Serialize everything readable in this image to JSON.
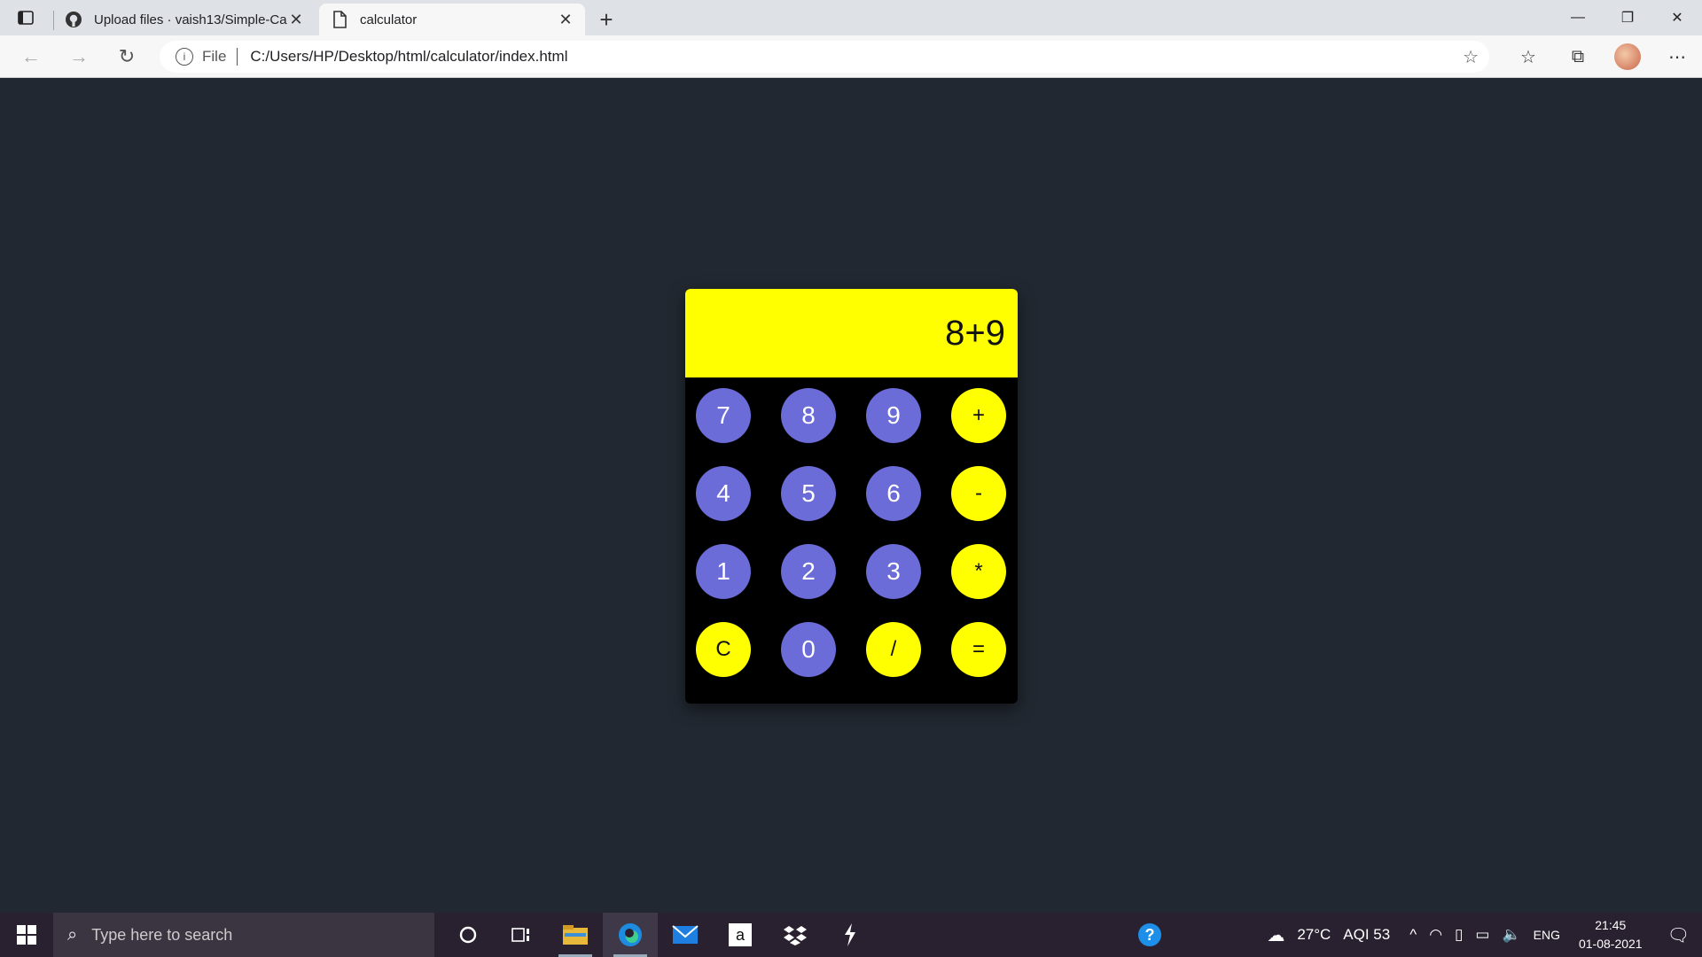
{
  "browser": {
    "tabs": [
      {
        "title": "Upload files · vaish13/Simple-Cal",
        "active": false,
        "favicon": "github-icon"
      },
      {
        "title": "calculator",
        "active": true,
        "favicon": "page-icon"
      }
    ],
    "address": {
      "scheme_label": "File",
      "url": "C:/Users/HP/Desktop/html/calculator/index.html"
    }
  },
  "calculator": {
    "display": "8+9",
    "keys": [
      {
        "label": "7",
        "type": "num"
      },
      {
        "label": "8",
        "type": "num"
      },
      {
        "label": "9",
        "type": "num"
      },
      {
        "label": "+",
        "type": "op"
      },
      {
        "label": "4",
        "type": "num"
      },
      {
        "label": "5",
        "type": "num"
      },
      {
        "label": "6",
        "type": "num"
      },
      {
        "label": "-",
        "type": "op"
      },
      {
        "label": "1",
        "type": "num"
      },
      {
        "label": "2",
        "type": "num"
      },
      {
        "label": "3",
        "type": "num"
      },
      {
        "label": "*",
        "type": "op"
      },
      {
        "label": "C",
        "type": "op"
      },
      {
        "label": "0",
        "type": "num"
      },
      {
        "label": "/",
        "type": "op"
      },
      {
        "label": "=",
        "type": "op"
      }
    ],
    "colors": {
      "background": "#000000",
      "display": "#ffff00",
      "number_key": "#6c6cd9",
      "operator_key": "#ffff00",
      "page": "#222831"
    }
  },
  "taskbar": {
    "search_placeholder": "Type here to search",
    "weather": "27°C",
    "aqi": "AQI 53",
    "language": "ENG",
    "time": "21:45",
    "date": "01-08-2021"
  }
}
